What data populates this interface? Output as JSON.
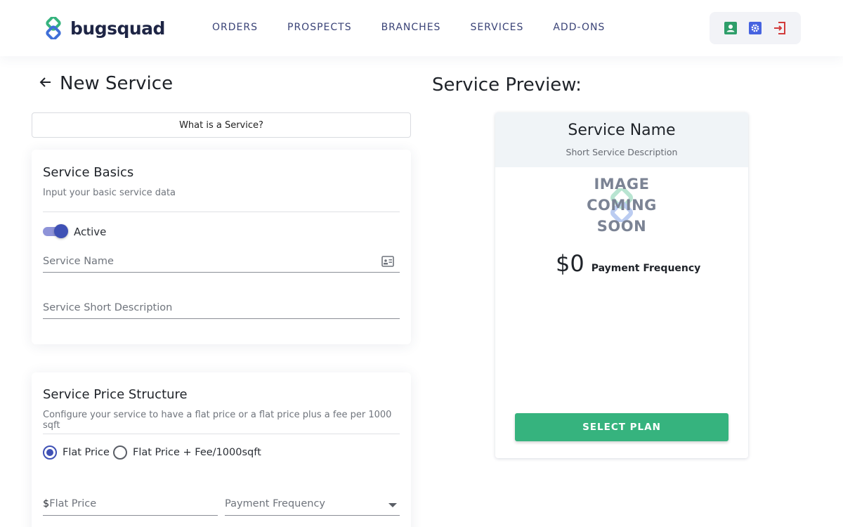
{
  "brand": {
    "name": "bugsquad"
  },
  "nav": {
    "items": [
      "ORDERS",
      "PROSPECTS",
      "BRANCHES",
      "SERVICES",
      "ADD-ONS"
    ]
  },
  "colors": {
    "accent": "#3f51b5",
    "brand_green": "#36b37e",
    "profile_icon": "#2e9e6a",
    "settings_icon": "#4663e0",
    "logout_icon": "#d23b3b"
  },
  "header_icons": [
    "profile-icon",
    "settings-icon",
    "logout-icon"
  ],
  "page": {
    "title": "New Service",
    "help_button": "What is a Service?"
  },
  "basics": {
    "title": "Service Basics",
    "subtitle": "Input your basic service data",
    "active_label": "Active",
    "active": true,
    "name_placeholder": "Service Name",
    "short_desc_placeholder": "Service Short Description"
  },
  "price_structure": {
    "title": "Service Price Structure",
    "subtitle": "Configure your service to have a flat price or a flat price plus a fee per 1000 sqft",
    "options": [
      "Flat Price",
      "Flat Price + Fee/1000sqft"
    ],
    "selected": "Flat Price",
    "flat_price_prefix": "$",
    "flat_price_placeholder": "Flat Price",
    "frequency_placeholder": "Payment Frequency"
  },
  "preview": {
    "title": "Service Preview:",
    "name": "Service Name",
    "short_desc": "Short Service Description",
    "image_lines": [
      "IMAGE",
      "COMING",
      "SOON"
    ],
    "price": "$0",
    "frequency": "Payment Frequency",
    "cta": "SELECT PLAN"
  }
}
